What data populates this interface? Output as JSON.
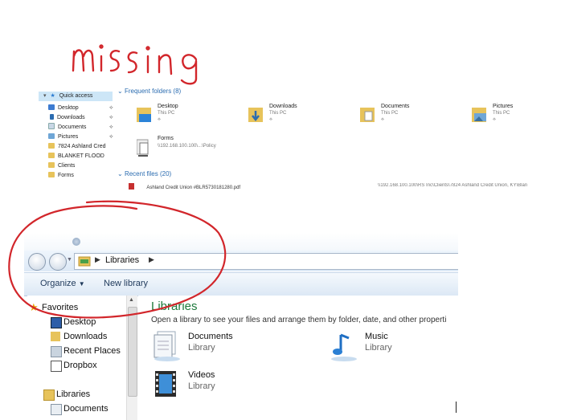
{
  "annotations": {
    "handwritten_note": "missing"
  },
  "win10": {
    "nav": {
      "quick_access": "Quick access",
      "items": [
        "Desktop",
        "Downloads",
        "Documents",
        "Pictures",
        "7824 Ashland Cred",
        "BLANKET FLOOD",
        "Clients",
        "Forms"
      ]
    },
    "frequent_header": "Frequent folders (8)",
    "folders": [
      {
        "name": "Desktop",
        "loc": "This PC"
      },
      {
        "name": "Downloads",
        "loc": "This PC"
      },
      {
        "name": "Documents",
        "loc": "This PC"
      },
      {
        "name": "Pictures",
        "loc": "This PC"
      },
      {
        "name": "Forms",
        "loc": "\\\\192.168.100.100\\...\\Policy"
      }
    ],
    "recent_header": "Recent files (20)",
    "recent_file": "Ashland Credit Union #BLR5730181280.pdf",
    "recent_path": "\\\\192.168.100.100\\RS Inc\\Clients\\7824 Ashland Credit Union, KY\\Blan"
  },
  "win7": {
    "breadcrumb": [
      "Libraries"
    ],
    "toolbar": {
      "organize": "Organize",
      "new_library": "New library"
    },
    "nav": {
      "favorites": "Favorites",
      "fav_items": [
        "Desktop",
        "Downloads",
        "Recent Places",
        "Dropbox"
      ],
      "libraries": "Libraries",
      "lib_items": [
        "Documents"
      ]
    },
    "main": {
      "title": "Libraries",
      "subtitle": "Open a library to see your files and arrange them by folder, date, and other properti",
      "libraries": [
        {
          "name": "Documents",
          "type": "Library"
        },
        {
          "name": "Music",
          "type": "Library"
        },
        {
          "name": "Videos",
          "type": "Library"
        }
      ]
    }
  },
  "colors": {
    "annotation_red": "#d2262b",
    "accent_blue": "#2b6cb0",
    "w7_title_green": "#1e7a3c"
  }
}
